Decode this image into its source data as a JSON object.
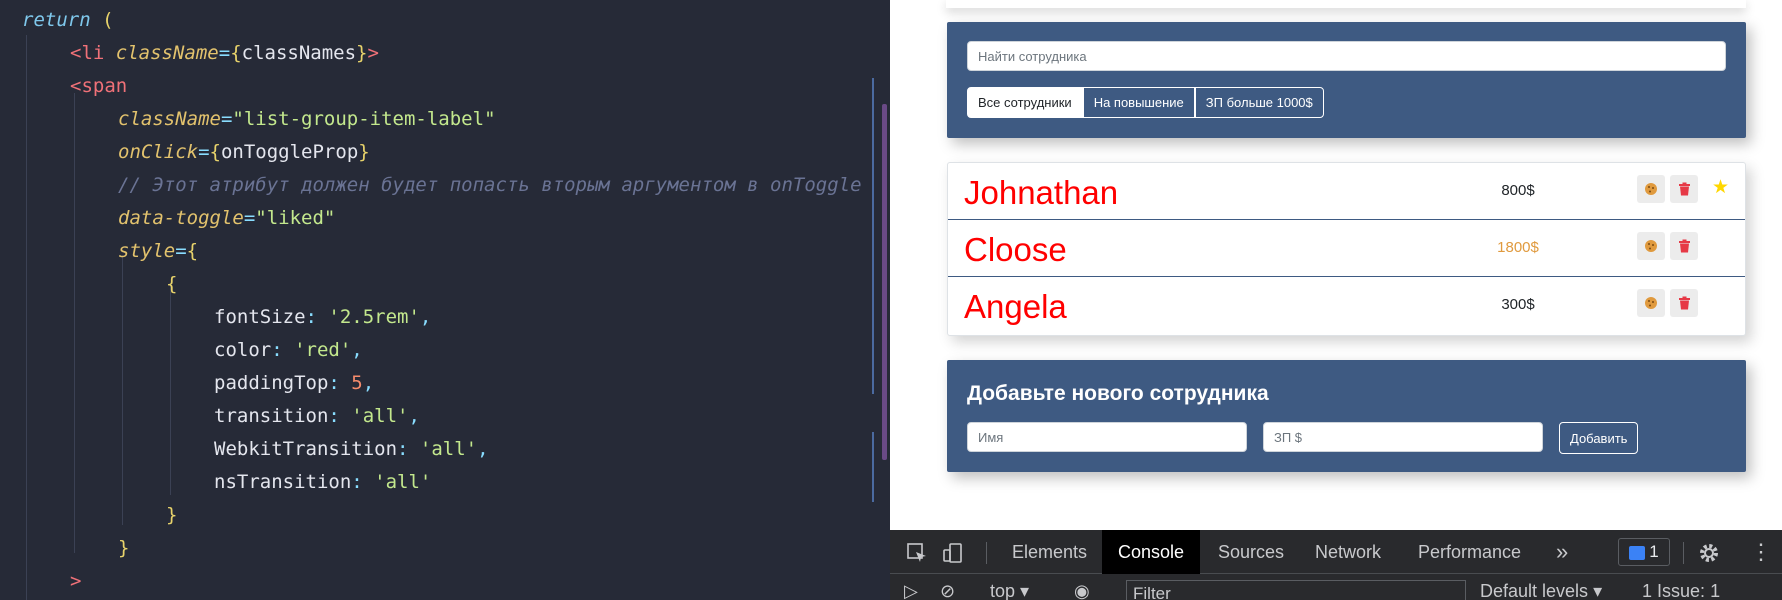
{
  "editor": {
    "lines": {
      "l0": "return",
      "l0b": "(",
      "l1_tag": "<li",
      "l1_attr": "className",
      "l1_val": "classNames",
      "l2_tag": "<span",
      "l3_attr": "className",
      "l3_val": "\"list-group-item-label\"",
      "l4_attr": "onClick",
      "l4_val": "onToggleProp",
      "l5_comment": "// Этот атрибут должен будет попасть вторым аргументом в onToggle",
      "l6_attr": "data-toggle",
      "l6_val": "\"liked\"",
      "l7_attr": "style",
      "l9_key": "fontSize",
      "l9_val": "'2.5rem'",
      "l10_key": "color",
      "l10_val": "'red'",
      "l11_key": "paddingTop",
      "l11_val": "5",
      "l12_key": "transition",
      "l12_val": "'all'",
      "l13_key": "WebkitTransition",
      "l13_val": "'all'",
      "l14_key": "nsTransition",
      "l14_val": "'all'",
      "l17": ">"
    }
  },
  "app": {
    "search": {
      "placeholder": "Найти сотрудника"
    },
    "filters": [
      {
        "label": "Все сотрудники",
        "active": true
      },
      {
        "label": "На повышение",
        "active": false
      },
      {
        "label": "ЗП больше 1000$",
        "active": false
      }
    ],
    "employees": [
      {
        "name": "Johnathan",
        "salary": "800$",
        "increase": false,
        "liked": true
      },
      {
        "name": "Cloose",
        "salary": "1800$",
        "increase": true,
        "liked": false
      },
      {
        "name": "Angela",
        "salary": "300$",
        "increase": false,
        "liked": false
      }
    ],
    "add_form": {
      "title": "Добавьте нового сотрудника",
      "name_placeholder": "Имя",
      "salary_placeholder": "ЗП $",
      "submit_label": "Добавить"
    }
  },
  "devtools": {
    "tabs": [
      "Elements",
      "Console",
      "Sources",
      "Network",
      "Performance"
    ],
    "active_tab": "Console",
    "more": "»",
    "message_count": "1",
    "context": "top",
    "filter_placeholder": "Filter",
    "levels": "Default levels",
    "issues_label": "1 Issue:",
    "issues_count": "1"
  },
  "colors": {
    "editor_bg": "#262a37",
    "panel_bg": "#3e5a82",
    "name_red": "#ff0000",
    "increase_salary": "#e09a3e",
    "star": "#ffd700",
    "trash": "#e63946",
    "cookie": "#e09a3e"
  }
}
